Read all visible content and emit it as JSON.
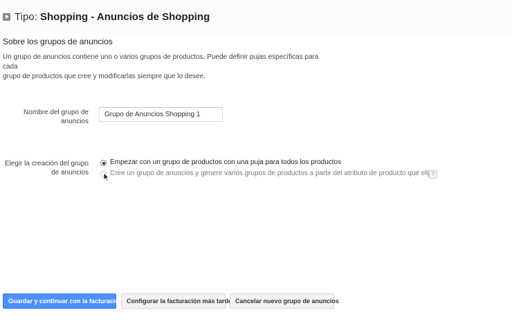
{
  "header": {
    "type_label": "Tipo:",
    "type_value": "Shopping - Anuncios de Shopping"
  },
  "section": {
    "title": "Sobre los grupos de anuncios",
    "description_line1": "Un grupo de anuncios contiene uno o varios grupos de productos. Puede definir pujas específicas para cada",
    "description_line2": "grupo de productos que cree y modificarlas siempre que lo desee."
  },
  "form": {
    "name_label_line1": "Nombre del grupo de",
    "name_label_line2": "anuncios",
    "name_value": "Grupo de Anuncios Shopping 1",
    "creation_label_line1": "Elegir la creación del grupo",
    "creation_label_line2": "de anuncios",
    "options": [
      {
        "label": "Empezar con un grupo de productos con una puja para todos los productos",
        "selected": true
      },
      {
        "label": "Cree un grupo de anuncios y genere varios grupos de productos a partir del atributo de producto que elija.",
        "selected": false
      }
    ],
    "help_glyph": "?"
  },
  "buttons": {
    "save": "Guardar y continuar con la facturación",
    "later": "Configurar la facturación más tarde",
    "cancel": "Cancelar nuevo grupo de anuncios"
  },
  "colors": {
    "primary": "#4d90fe",
    "background": "#ffffff"
  }
}
